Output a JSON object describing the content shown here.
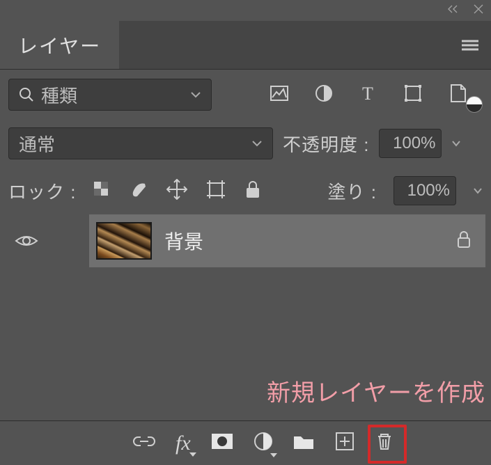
{
  "panel": {
    "tab_label": "レイヤー",
    "filter_label": "種類",
    "blend_label": "通常",
    "opacity_label": "不透明度 :",
    "opacity_value": "100%",
    "lock_label": "ロック :",
    "fill_label": "塗り :",
    "fill_value": "100%"
  },
  "layers": [
    {
      "name": "背景"
    }
  ],
  "annotation": "新規レイヤーを作成",
  "fx_label": "fx"
}
